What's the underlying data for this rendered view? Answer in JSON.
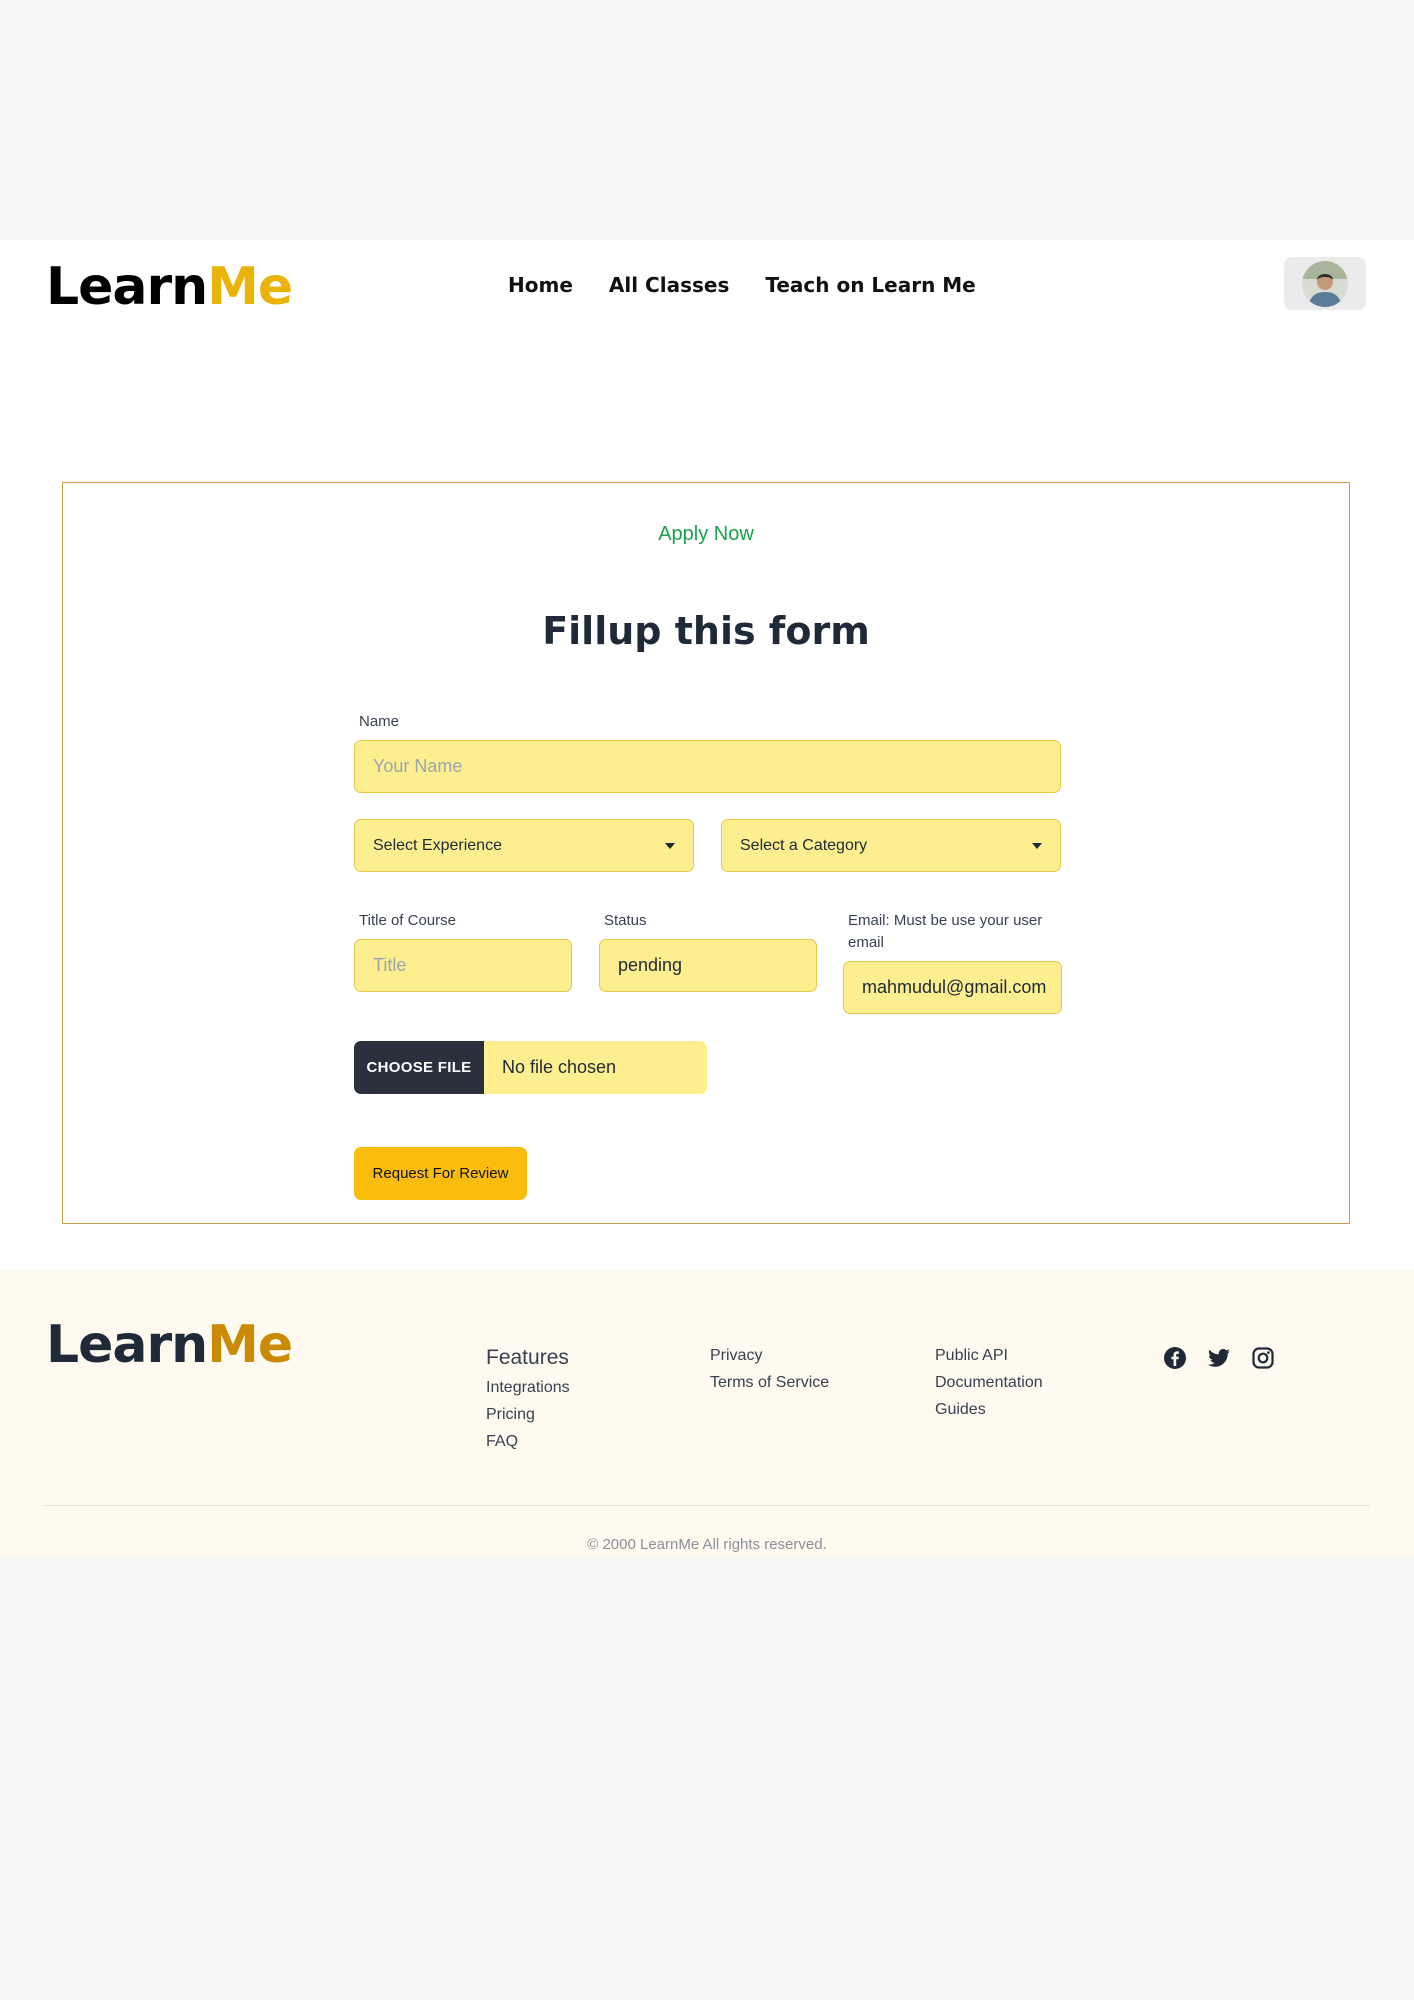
{
  "navbar": {
    "brand": {
      "part1": "Learn",
      "part2": "Me"
    },
    "links": [
      {
        "label": "Home"
      },
      {
        "label": "All Classes"
      },
      {
        "label": "Teach on Learn Me"
      }
    ]
  },
  "form": {
    "tag": "Apply Now",
    "title": "Fillup this form",
    "name": {
      "label": "Name",
      "placeholder": "Your Name"
    },
    "experience": {
      "selected": "Select Experience"
    },
    "category": {
      "selected": "Select a Category"
    },
    "course_title": {
      "label": "Title of Course",
      "placeholder": "Title"
    },
    "status": {
      "label": "Status",
      "value": "pending"
    },
    "email": {
      "label": "Email: Must be use your user email",
      "value": "mahmudul@gmail.com"
    },
    "file": {
      "button": "CHOOSE FILE",
      "status": "No file chosen"
    },
    "submit_label": "Request For Review"
  },
  "footer": {
    "brand": {
      "part1": "Learn",
      "part2": "Me"
    },
    "col1": {
      "items": [
        "Features",
        "Integrations",
        "Pricing",
        "FAQ"
      ]
    },
    "col2": {
      "items": [
        "Privacy",
        "Terms of Service"
      ]
    },
    "col3": {
      "items": [
        "Public API",
        "Documentation",
        "Guides"
      ]
    },
    "social": [
      "facebook-icon",
      "twitter-icon",
      "instagram-icon"
    ],
    "copyright": "© 2000 LearnMe All rights reserved."
  },
  "colors": {
    "accent_yellow": "#fbbd0d",
    "input_yellow": "#fdef8f",
    "apply_green": "#16a34a",
    "card_border": "#c9a14a",
    "file_button": "#2a303c"
  }
}
